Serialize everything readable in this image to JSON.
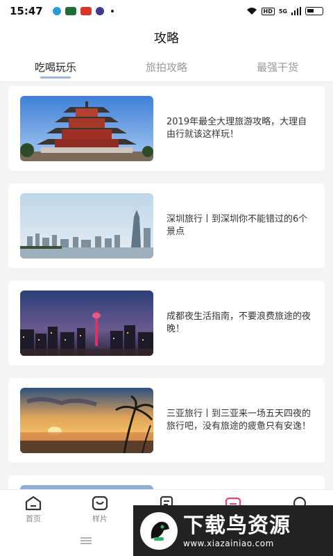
{
  "status": {
    "time": "15:47",
    "network_label": "HD",
    "signal_label": "5G"
  },
  "header": {
    "title": "攻略"
  },
  "tabs": [
    {
      "label": "吃喝玩乐",
      "active": true
    },
    {
      "label": "旅拍攻略",
      "active": false
    },
    {
      "label": "最强干货",
      "active": false
    }
  ],
  "articles": [
    {
      "image": "pavilion-photo",
      "title": "2019年最全大理旅游攻略，大理自由行就该这样玩！"
    },
    {
      "image": "city-skyline-photo",
      "title": "深圳旅行丨到深圳你不能错过的6个景点"
    },
    {
      "image": "night-city-photo",
      "title": "成都夜生活指南，不要浪费旅途的夜晚！"
    },
    {
      "image": "sunset-beach-photo",
      "title": "三亚旅行丨到三亚来一场五天四夜的旅行吧，没有旅途的疲惫只有安逸！"
    }
  ],
  "bottom_nav": [
    {
      "label": "首页",
      "icon": "home-icon"
    },
    {
      "label": "样片",
      "icon": "samples-icon"
    },
    {
      "label": "",
      "icon": "document-icon"
    },
    {
      "label": "",
      "icon": "calendar-icon"
    },
    {
      "label": "",
      "icon": "chat-icon"
    }
  ],
  "watermark": {
    "title": "下载鸟资源",
    "url": "www.xiazainiao.com"
  },
  "colors": {
    "tab_indicator": "#9fb4de",
    "accent_pink": "#e0457b"
  }
}
